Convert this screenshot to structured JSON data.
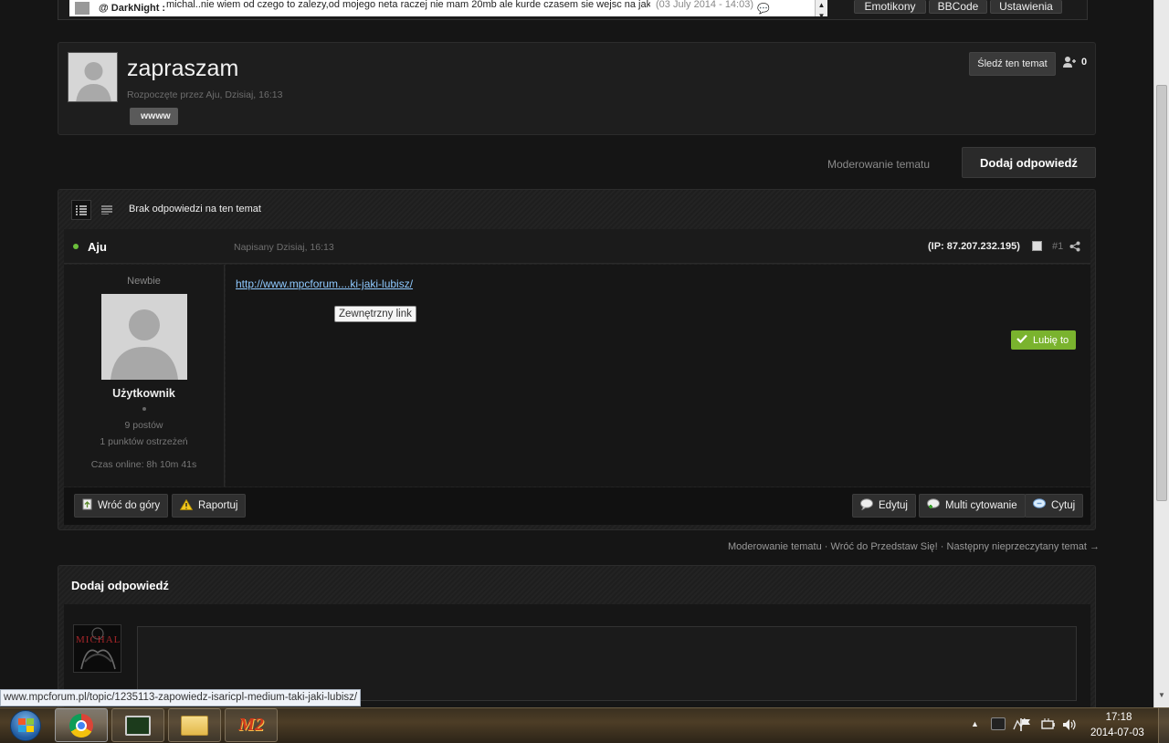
{
  "shoutbox": {
    "user": "DarkNight",
    "message": "michal..nie wiem od czego to zalezy,od mojego neta raczej nie mam 20mb ale kurde czasem sie wejsc na jakis",
    "time": "(03 July 2014 - 14:03)",
    "tabs": [
      "Emotikony",
      "BBCode",
      "Ustawienia"
    ]
  },
  "topic": {
    "title": "zapraszam",
    "started_by": "Rozpoczęte przez Aju, Dzisiaj, 16:13",
    "tag": "wwww",
    "follow_label": "Śledź ten temat",
    "followers": "0"
  },
  "actions": {
    "moderate": "Moderowanie tematu",
    "add_reply": "Dodaj odpowiedź"
  },
  "post_list": {
    "no_replies": "Brak odpowiedzi na ten temat"
  },
  "post": {
    "author": "Aju",
    "posted": "Napisany Dzisiaj, 16:13",
    "ip": "(IP: 87.207.232.195)",
    "number": "#1",
    "rank": "Newbie",
    "group": "Użytkownik",
    "posts": "9 postów",
    "warnings": "1 punktów ostrzeżeń",
    "online": "Czas online: 8h 10m 41s",
    "link": "http://www.mpcforum....ki-jaki-lubisz/",
    "tooltip": "Zewnętrzny link",
    "like": "Lubię to",
    "back_top": "Wróć do góry",
    "report": "Raportuj",
    "edit": "Edytuj",
    "multiquote": "Multi cytowanie",
    "quote": "Cytuj"
  },
  "footer_nav": {
    "moderate": "Moderowanie tematu",
    "back": "Wróć do Przedstaw Się!",
    "next": "Następny nieprzeczytany temat →"
  },
  "reply": {
    "title": "Dodaj odpowiedź",
    "avatar_text": "MICHAL"
  },
  "statusbar": {
    "url": "www.mpcforum.pl/topic/1235113-zapowiedz-isaricpl-medium-taki-jaki-lubisz/"
  },
  "taskbar": {
    "time": "17:18",
    "date": "2014-07-03",
    "app_m2": "M2"
  },
  "colors": {
    "accent_green": "#7ab32e",
    "online_dot": "#6bbf3b",
    "link": "#8fc9ff"
  }
}
